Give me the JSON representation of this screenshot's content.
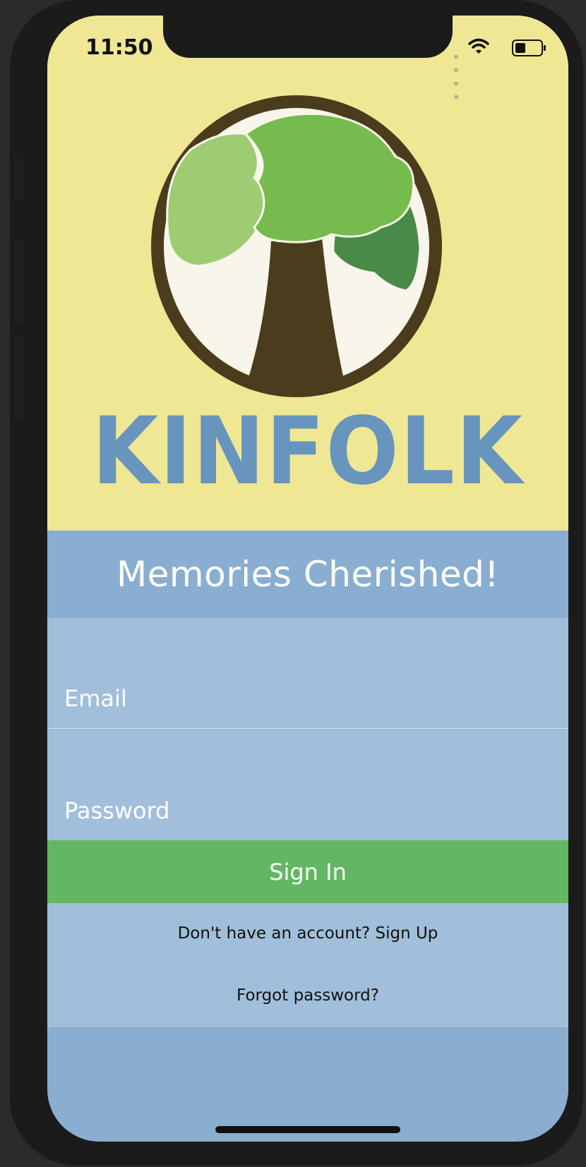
{
  "status_bar": {
    "time": "11:50"
  },
  "brand": {
    "name": "KINFOLK"
  },
  "tagline": "Memories Cherished!",
  "form": {
    "email_placeholder": "Email",
    "password_placeholder": "Password",
    "sign_in_label": "Sign In"
  },
  "links": {
    "sign_up": "Don't have an account? Sign Up",
    "forgot_password": "Forgot password?"
  },
  "colors": {
    "header_bg": "#efe793",
    "tagline_bg": "#89aed1",
    "form_bg": "#a1bfda",
    "button_bg": "#62b862",
    "logo_text": "#6795bd"
  },
  "icons": [
    "signal-icon",
    "wifi-icon",
    "battery-icon",
    "tree-logo-icon"
  ]
}
